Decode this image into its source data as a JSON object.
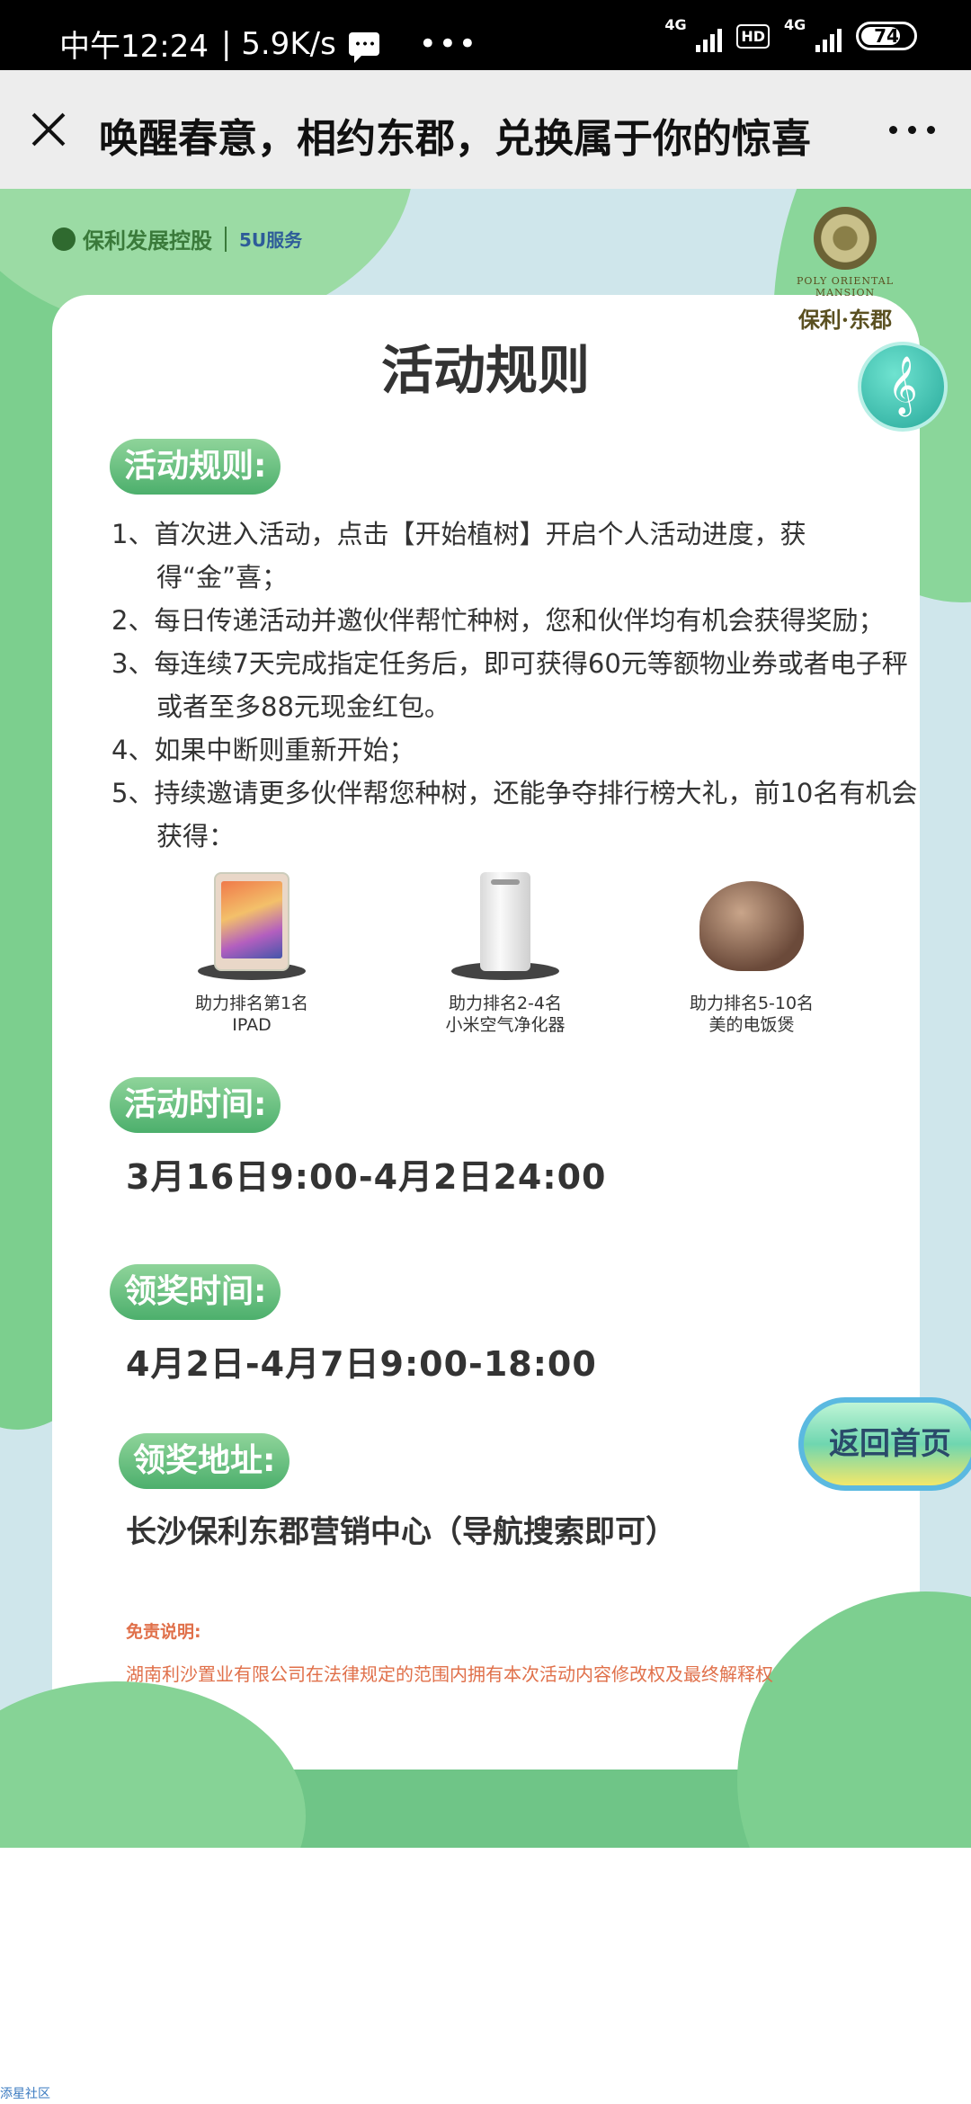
{
  "status_bar": {
    "time": "中午12:24",
    "speed": "| 5.9K/s",
    "net1": "4G",
    "net2": "4G",
    "hd": "HD",
    "battery": "74"
  },
  "title_bar": {
    "title": "唤醒春意，相约东郡，兑换属于你的惊喜"
  },
  "poster": {
    "brand_name": "保利发展控股",
    "brand_service": "5U服务",
    "emblem_en": "POLY ORIENTAL MANSION",
    "emblem_cn": "保利·东郡",
    "music_icon": "𝄞",
    "heading": "活动规则",
    "rules_label": "活动规则:",
    "rules": [
      "1、首次进入活动，点击【开始植树】开启个人活动进度，获得“金”喜；",
      "2、每日传递活动并邀伙伴帮忙种树，您和伙伴均有机会获得奖励；",
      "3、每连续7天完成指定任务后，即可获得60元等额物业券或者电子秤或者至多88元现金红包。",
      "4、如果中断则重新开始；",
      "5、持续邀请更多伙伴帮您种树，还能争夺排行榜大礼，前10名有机会获得："
    ],
    "prizes": [
      {
        "rank": "助力排名第1名",
        "item": "IPAD"
      },
      {
        "rank": "助力排名2-4名",
        "item": "小米空气净化器"
      },
      {
        "rank": "助力排名5-10名",
        "item": "美的电饭煲"
      }
    ],
    "time_label": "活动时间:",
    "time_value": "3月16日9:00-4月2日24:00",
    "claim_label": "领奖时间:",
    "claim_value": "4月2日-4月7日9:00-18:00",
    "address_label": "领奖地址:",
    "address_value": "长沙保利东郡营销中心（导航搜索即可）",
    "disclaimer_title": "免责说明:",
    "disclaimer_text": "湖南利沙置业有限公司在法律规定的范围内拥有本次活动内容修改权及最终解释权",
    "home_button": "返回首页"
  },
  "footer": {
    "note": "添星社区"
  },
  "colors": {
    "pill_green": "#4caf6c",
    "background_blue": "#cfe6eb",
    "disclaimer": "#e0704a"
  }
}
